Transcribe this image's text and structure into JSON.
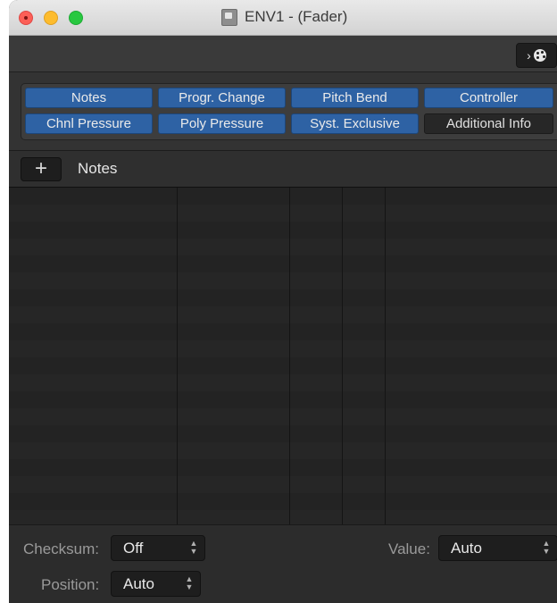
{
  "window": {
    "title": "ENV1 - (Fader)",
    "doc_icon": "document-icon"
  },
  "toolbar": {
    "view_button_chevron": "›",
    "view_button_icon": "palette-icon"
  },
  "filters": [
    {
      "label": "Notes",
      "active": true
    },
    {
      "label": "Progr. Change",
      "active": true
    },
    {
      "label": "Pitch Bend",
      "active": true
    },
    {
      "label": "Controller",
      "active": true
    },
    {
      "label": "Chnl Pressure",
      "active": true
    },
    {
      "label": "Poly Pressure",
      "active": true
    },
    {
      "label": "Syst. Exclusive",
      "active": true
    },
    {
      "label": "Additional Info",
      "active": false
    }
  ],
  "list_header": {
    "add_symbol": "+",
    "label": "Notes"
  },
  "bottom": {
    "checksum_label": "Checksum:",
    "checksum_value": "Off",
    "value_label": "Value:",
    "value_value": "Auto",
    "position_label": "Position:",
    "position_value": "Auto"
  },
  "colors": {
    "active_button": "#2e62a4",
    "inactive_button": "#272727",
    "background": "#2a2a2a"
  }
}
